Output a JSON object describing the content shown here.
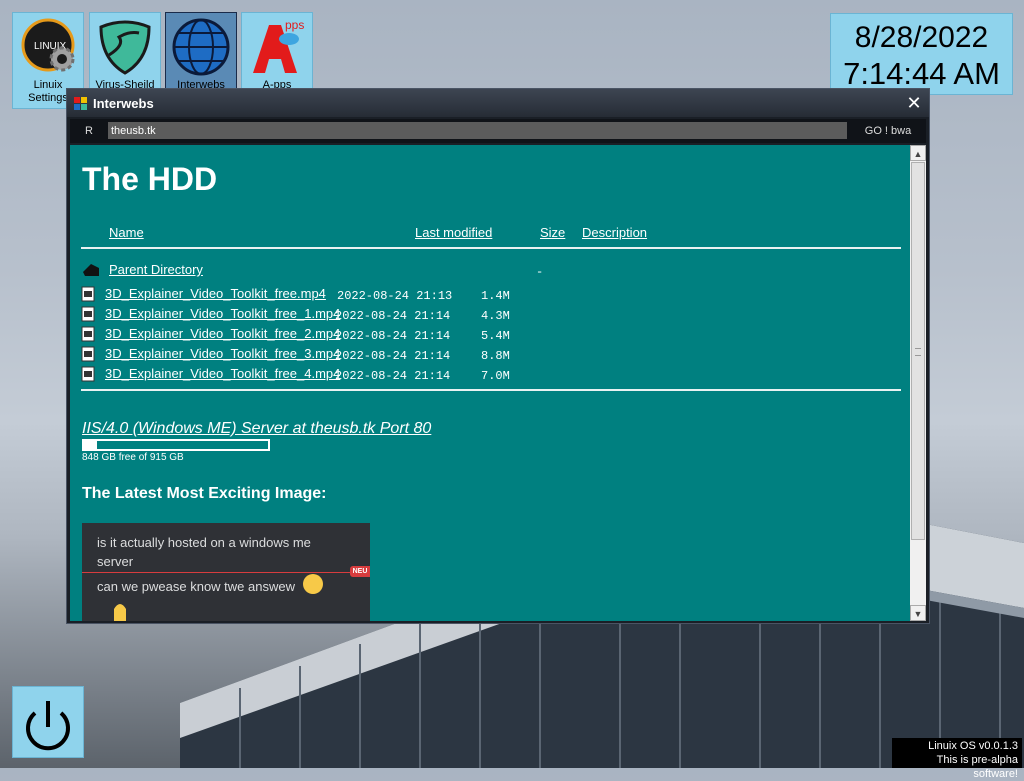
{
  "desktop": {
    "icons": [
      {
        "label_line1": "Linuix",
        "label_line2": "Settings",
        "icon": "linuix-settings-icon"
      },
      {
        "label_line1": "Virus-Sheild",
        "label_line2": "",
        "icon": "shield-icon"
      },
      {
        "label_line1": "Interwebs",
        "label_line2": "",
        "icon": "globe-icon"
      },
      {
        "label_line1": "A-pps",
        "label_line2": "",
        "icon": "apps-icon"
      }
    ],
    "clock": {
      "date": "8/28/2022",
      "time": "7:14:44 AM"
    },
    "power_icon": "power-icon",
    "version": {
      "line1": "Linuix OS v0.0.1.3",
      "line2": "This is pre-alpha software!"
    }
  },
  "window": {
    "title": "Interwebs",
    "close_label": "✕",
    "refresh_label": "R",
    "url": "theusb.tk",
    "go_label": "GO ! bwa"
  },
  "page": {
    "heading": "The HDD",
    "columns": [
      "Name",
      "Last modified",
      "Size",
      "Description"
    ],
    "parent": {
      "name": "Parent Directory",
      "size": "-"
    },
    "files": [
      {
        "name": "3D_Explainer_Video_Toolkit_free.mp4",
        "modified": "2022-08-24 21:13",
        "size": "1.4M"
      },
      {
        "name": "3D_Explainer_Video_Toolkit_free_1.mp4",
        "modified": "2022-08-24 21:14",
        "size": "4.3M"
      },
      {
        "name": "3D_Explainer_Video_Toolkit_free_2.mp4",
        "modified": "2022-08-24 21:14",
        "size": "5.4M"
      },
      {
        "name": "3D_Explainer_Video_Toolkit_free_3.mp4",
        "modified": "2022-08-24 21:14",
        "size": "8.8M"
      },
      {
        "name": "3D_Explainer_Video_Toolkit_free_4.mp4",
        "modified": "2022-08-24 21:14",
        "size": "7.0M"
      }
    ],
    "server_address": "IIS/4.0 (Windows ME) Server at theusb.tk Port 80",
    "disk": {
      "used_fraction": 0.073,
      "text": "848 GB free of 915 GB"
    },
    "latest_heading": "The Latest Most Exciting Image:",
    "meme": {
      "line1": "is it actually hosted on a windows me server",
      "line2": "can we pwease know twe answew",
      "badge": "NEU"
    }
  }
}
